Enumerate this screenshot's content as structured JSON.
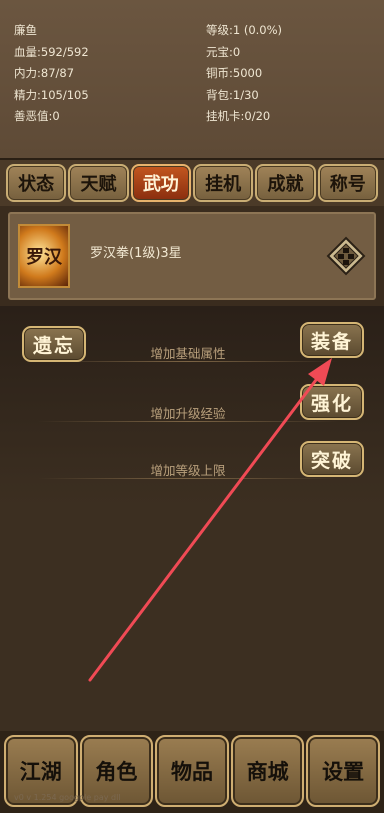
{
  "player": {
    "name": "廉鱼",
    "hp": "血量:592/592",
    "mp": "内力:87/87",
    "stamina": "精力:105/105",
    "karma": "善恶值:0",
    "level": "等级:1 (0.0%)",
    "ingot": "元宝:0",
    "copper": "铜币:5000",
    "bag": "背包:1/30",
    "afk_card": "挂机卡:0/20"
  },
  "tabs": [
    {
      "label": "状态"
    },
    {
      "label": "天赋"
    },
    {
      "label": "武功",
      "active": true
    },
    {
      "label": "挂机"
    },
    {
      "label": "成就"
    },
    {
      "label": "称号"
    }
  ],
  "skill": {
    "icon_text": "罗汉",
    "name": "罗汉拳(1级)3星"
  },
  "actions": {
    "forget": "遗忘",
    "equip": "装备",
    "enhance": "强化",
    "breakthrough": "突破",
    "row1": "增加基础属性",
    "row2": "增加升级经验",
    "row3": "增加等级上限"
  },
  "bottom_nav": [
    {
      "label": "江湖"
    },
    {
      "label": "角色"
    },
    {
      "label": "物品"
    },
    {
      "label": "商城"
    },
    {
      "label": "设置"
    }
  ],
  "version": "v0 v 1.254 googple pay dll",
  "colors": {
    "active_tab": "#c3571f",
    "annotation_arrow": "#f04a55"
  }
}
